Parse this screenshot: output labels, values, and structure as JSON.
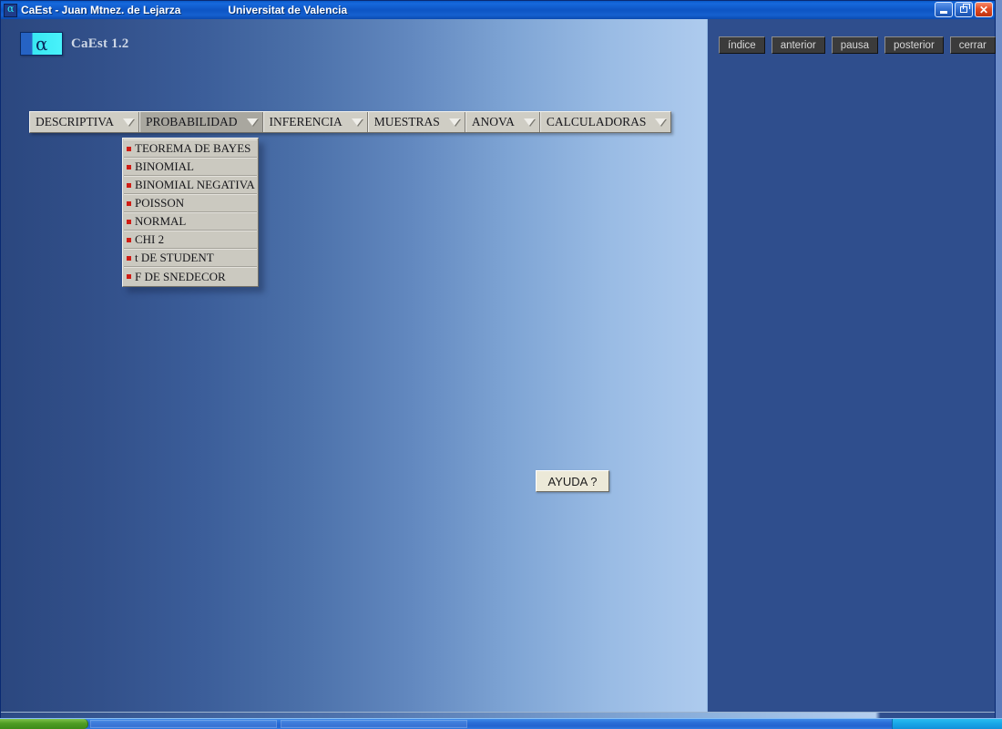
{
  "window": {
    "title": "CaEst - Juan Mtnez. de Lejarza",
    "subtitle": "Universitat de Valencia",
    "icon": "app-alpha-icon",
    "controls": {
      "minimize_label": "_",
      "restore_label": "❐",
      "close_label": "✕"
    }
  },
  "branding": {
    "logo_glyph": "α",
    "app_name": "CaEst 1.2"
  },
  "menubar": {
    "items": [
      {
        "label": "DESCRIPTIVA",
        "caret": "▼",
        "active": false
      },
      {
        "label": "PROBABILIDAD",
        "caret": "▼",
        "active": true
      },
      {
        "label": "INFERENCIA",
        "caret": "▼",
        "active": false
      },
      {
        "label": "MUESTRAS",
        "caret": "▼",
        "active": false
      },
      {
        "label": "ANOVA",
        "caret": "▼",
        "active": false
      },
      {
        "label": "CALCULADORAS",
        "caret": "▼",
        "active": false
      }
    ]
  },
  "dropdown": {
    "parent": "PROBABILIDAD",
    "bullet_color": "#d01d16",
    "items": [
      {
        "label": "TEOREMA DE BAYES"
      },
      {
        "label": "BINOMIAL"
      },
      {
        "label": "BINOMIAL NEGATIVA"
      },
      {
        "label": "POISSON"
      },
      {
        "label": "NORMAL"
      },
      {
        "label": "CHI 2"
      },
      {
        "label": "t DE STUDENT"
      },
      {
        "label": "F DE SNEDECOR"
      }
    ]
  },
  "help": {
    "label": "AYUDA ?"
  },
  "navigation": {
    "buttons": [
      {
        "label": "índice"
      },
      {
        "label": "anterior"
      },
      {
        "label": "pausa"
      },
      {
        "label": "posterior"
      },
      {
        "label": "cerrar"
      }
    ]
  },
  "colors": {
    "titlebar_blue": "#0d55c4",
    "main_gradient_left": "#2b477f",
    "main_gradient_right": "#aecbee",
    "right_panel": "#2f4e8d",
    "nav_button": "#3b3b3b",
    "menu_face": "#cfcdc4",
    "menu_active": "#a9a79f",
    "help_face": "#ece9d8",
    "close_red": "#e24a21",
    "start_green": "#4e9c24"
  }
}
